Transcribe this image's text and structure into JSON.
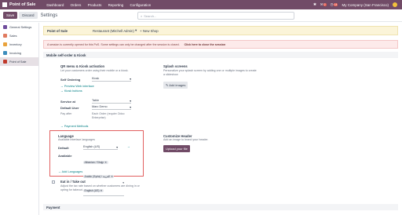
{
  "topbar": {
    "app_name": "Point of Sale",
    "menu": [
      "Dashboard",
      "Orders",
      "Products",
      "Reporting",
      "Configuration"
    ],
    "chat_badge": "2",
    "activity_badge": "14",
    "company": "My Company (San Francisco)"
  },
  "controlbar": {
    "save_label": "Save",
    "discard_label": "Discard",
    "breadcrumb": "Settings",
    "search_placeholder": "Search..."
  },
  "sidebar": {
    "items": [
      {
        "label": "General Settings",
        "color": "#6f4d9c"
      },
      {
        "label": "Sales",
        "color": "#e07a5f"
      },
      {
        "label": "Inventory",
        "color": "#e9a23b"
      },
      {
        "label": "Invoicing",
        "color": "#3c8dbc"
      },
      {
        "label": "Point of Sale",
        "color": "#c0392b"
      }
    ]
  },
  "pos_selector": {
    "label": "Point of Sale",
    "value": "Restaurant (Mitchell Admin)",
    "new_shop": "+ New Shop"
  },
  "warning": {
    "text": "A session is currently opened for this PoS. Some settings can only be changed after the session is closed.",
    "link": "Click here to close the session"
  },
  "mobile_section": {
    "title": "Mobile self-order & Kiosk",
    "qr": {
      "title": "QR menu & Kiosk activation",
      "desc": "Let your customers order using their mobile or a kiosk.",
      "self_ordering_label": "Self Ordering",
      "self_ordering_value": "Kiosk",
      "preview_link": "Preview Web interface",
      "buttons_link": "Kiosk buttons"
    },
    "service": {
      "service_at_label": "Service at",
      "service_at_value": "Table",
      "default_user_label": "Default User",
      "default_user_value": "Marc Demo",
      "pay_after_label": "Pay after",
      "pay_after_value": "Each Order (require Odoo Enterprise)",
      "payment_link": "Payment Methods"
    },
    "splash": {
      "title": "Splash screens",
      "desc": "Personalize your splash screen by adding one or multiple images to create a slideshow",
      "button": "Add images"
    },
    "language": {
      "title": "Language",
      "desc": "Available interface languages",
      "default_label": "Default",
      "default_value": "English (US)",
      "available_label": "Available",
      "tags": [
        "Albanian / Shqip",
        "Arabic (Syria) / العربية",
        "English (US)"
      ],
      "add_link": "Add Languages"
    },
    "customize_header": {
      "title": "Customize Header",
      "desc": "Add an image to brand your header.",
      "button": "Upload your file"
    },
    "eat_in": {
      "title": "Eat in / Take out",
      "desc": "Adjust the tax rate based on whether customers are dining in or opting for takeout."
    }
  },
  "payment_section": {
    "title": "Payment"
  }
}
